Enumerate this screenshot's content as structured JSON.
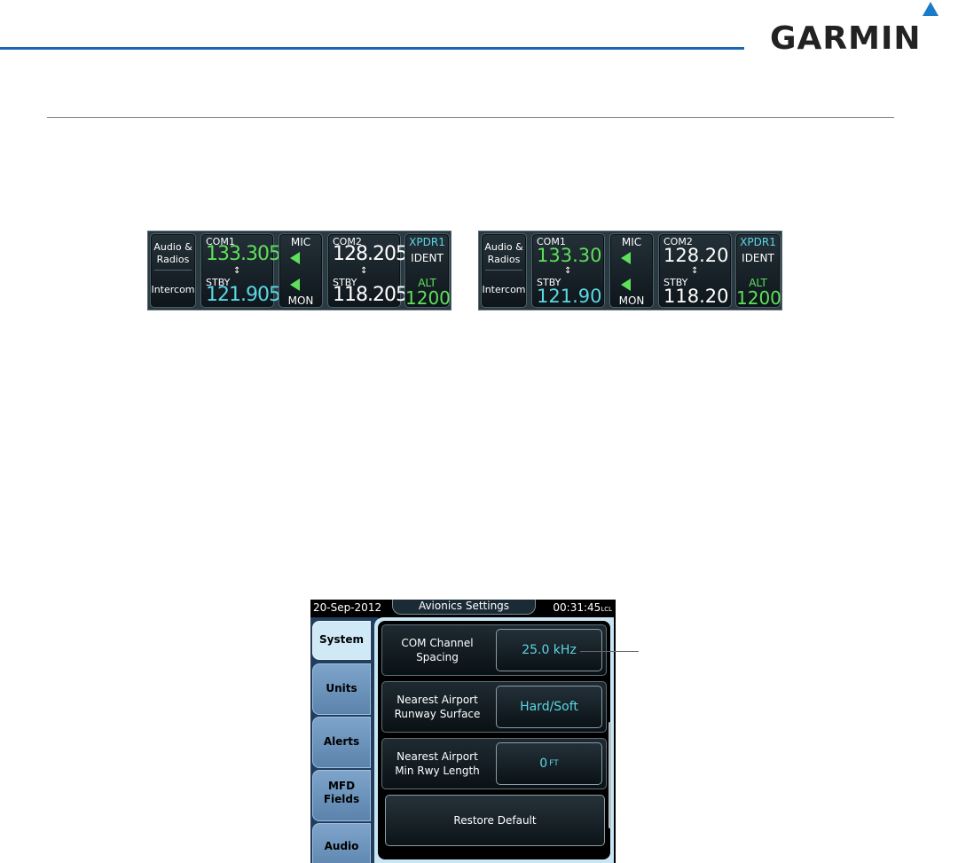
{
  "brand": {
    "logo_text": "GARMIN"
  },
  "radio_strips": [
    {
      "audio_button": {
        "line1": "Audio &",
        "line2": "Radios"
      },
      "intercom_label": "Intercom",
      "com1": {
        "label": "COM1",
        "active": "133.305",
        "stby_label": "STBY",
        "standby": "121.905"
      },
      "mic_label": "MIC",
      "mon_label": "MON",
      "com2": {
        "label": "COM2",
        "active": "128.205",
        "stby_label": "STBY",
        "standby": "118.205"
      },
      "xpdr": {
        "label": "XPDR1",
        "ident": "IDENT",
        "mode": "ALT",
        "code": "1200"
      }
    },
    {
      "audio_button": {
        "line1": "Audio &",
        "line2": "Radios"
      },
      "intercom_label": "Intercom",
      "com1": {
        "label": "COM1",
        "active": "133.30",
        "stby_label": "STBY",
        "standby": "121.90"
      },
      "mic_label": "MIC",
      "mon_label": "MON",
      "com2": {
        "label": "COM2",
        "active": "128.20",
        "stby_label": "STBY",
        "standby": "118.20"
      },
      "xpdr": {
        "label": "XPDR1",
        "ident": "IDENT",
        "mode": "ALT",
        "code": "1200"
      }
    }
  ],
  "avionics": {
    "date": "20-Sep-2012",
    "title": "Avionics Settings",
    "time": "00:31:45",
    "tz": "LCL",
    "tabs": [
      "System",
      "Units",
      "Alerts",
      "MFD Fields",
      "Audio"
    ],
    "tab_mfd_line1": "MFD",
    "tab_mfd_line2": "Fields",
    "rows": [
      {
        "label_line1": "COM Channel",
        "label_line2": "Spacing",
        "value": "25.0 kHz",
        "unit": ""
      },
      {
        "label_line1": "Nearest Airport",
        "label_line2": "Runway Surface",
        "value": "Hard/Soft",
        "unit": ""
      },
      {
        "label_line1": "Nearest Airport",
        "label_line2": "Min Rwy Length",
        "value": "0",
        "unit": "FT"
      }
    ],
    "restore_label": "Restore Default"
  }
}
